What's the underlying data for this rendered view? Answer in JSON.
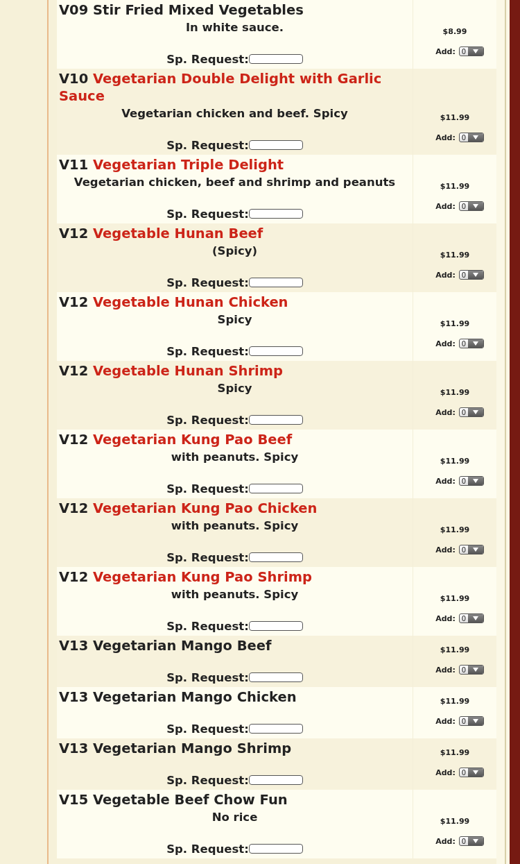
{
  "menu_items": [
    {
      "code": "V09",
      "name": "Stir Fried Mixed Vegetables",
      "color": "#222222",
      "description": "In white sauce.",
      "price": "$8.99",
      "request_label": "Sp. Request:",
      "add_label": "Add:",
      "quantity": "0"
    },
    {
      "code": "V10",
      "name": "Vegetarian Double Delight with Garlic Sauce",
      "color": "#cc2418",
      "description": "Vegetarian chicken and beef. Spicy",
      "price": "$11.99",
      "request_label": "Sp. Request:",
      "add_label": "Add:",
      "quantity": "0"
    },
    {
      "code": "V11",
      "name": "Vegetarian Triple Delight",
      "color": "#cc2418",
      "description": "Vegetarian chicken, beef and shrimp and peanuts",
      "price": "$11.99",
      "request_label": "Sp. Request:",
      "add_label": "Add:",
      "quantity": "0"
    },
    {
      "code": "V12",
      "name": "Vegetable Hunan Beef",
      "color": "#cc2418",
      "description": "(Spicy)",
      "price": "$11.99",
      "request_label": "Sp. Request:",
      "add_label": "Add:",
      "quantity": "0"
    },
    {
      "code": "V12",
      "name": "Vegetable Hunan Chicken",
      "color": "#cc2418",
      "description": "Spicy",
      "price": "$11.99",
      "request_label": "Sp. Request:",
      "add_label": "Add:",
      "quantity": "0"
    },
    {
      "code": "V12",
      "name": "Vegetable Hunan Shrimp",
      "color": "#cc2418",
      "description": "Spicy",
      "price": "$11.99",
      "request_label": "Sp. Request:",
      "add_label": "Add:",
      "quantity": "0"
    },
    {
      "code": "V12",
      "name": "Vegetarian Kung Pao Beef",
      "color": "#cc2418",
      "description": "with peanuts. Spicy",
      "price": "$11.99",
      "request_label": "Sp. Request:",
      "add_label": "Add:",
      "quantity": "0"
    },
    {
      "code": "V12",
      "name": "Vegetarian Kung Pao Chicken",
      "color": "#cc2418",
      "description": "with peanuts. Spicy",
      "price": "$11.99",
      "request_label": "Sp. Request:",
      "add_label": "Add:",
      "quantity": "0"
    },
    {
      "code": "V12",
      "name": "Vegetarian Kung Pao Shrimp",
      "color": "#cc2418",
      "description": "with peanuts. Spicy",
      "price": "$11.99",
      "request_label": "Sp. Request:",
      "add_label": "Add:",
      "quantity": "0"
    },
    {
      "code": "V13",
      "name": "Vegetarian Mango Beef",
      "color": "#222222",
      "price": "$11.99",
      "request_label": "Sp. Request:",
      "add_label": "Add:",
      "quantity": "0"
    },
    {
      "code": "V13",
      "name": "Vegetarian Mango Chicken",
      "color": "#222222",
      "price": "$11.99",
      "request_label": "Sp. Request:",
      "add_label": "Add:",
      "quantity": "0"
    },
    {
      "code": "V13",
      "name": "Vegetarian Mango Shrimp",
      "color": "#222222",
      "price": "$11.99",
      "request_label": "Sp. Request:",
      "add_label": "Add:",
      "quantity": "0"
    },
    {
      "code": "V15",
      "name": "Vegetable Beef Chow Fun",
      "color": "#222222",
      "description": "No rice",
      "price": "$11.99",
      "request_label": "Sp. Request:",
      "add_label": "Add:",
      "quantity": "0"
    }
  ]
}
